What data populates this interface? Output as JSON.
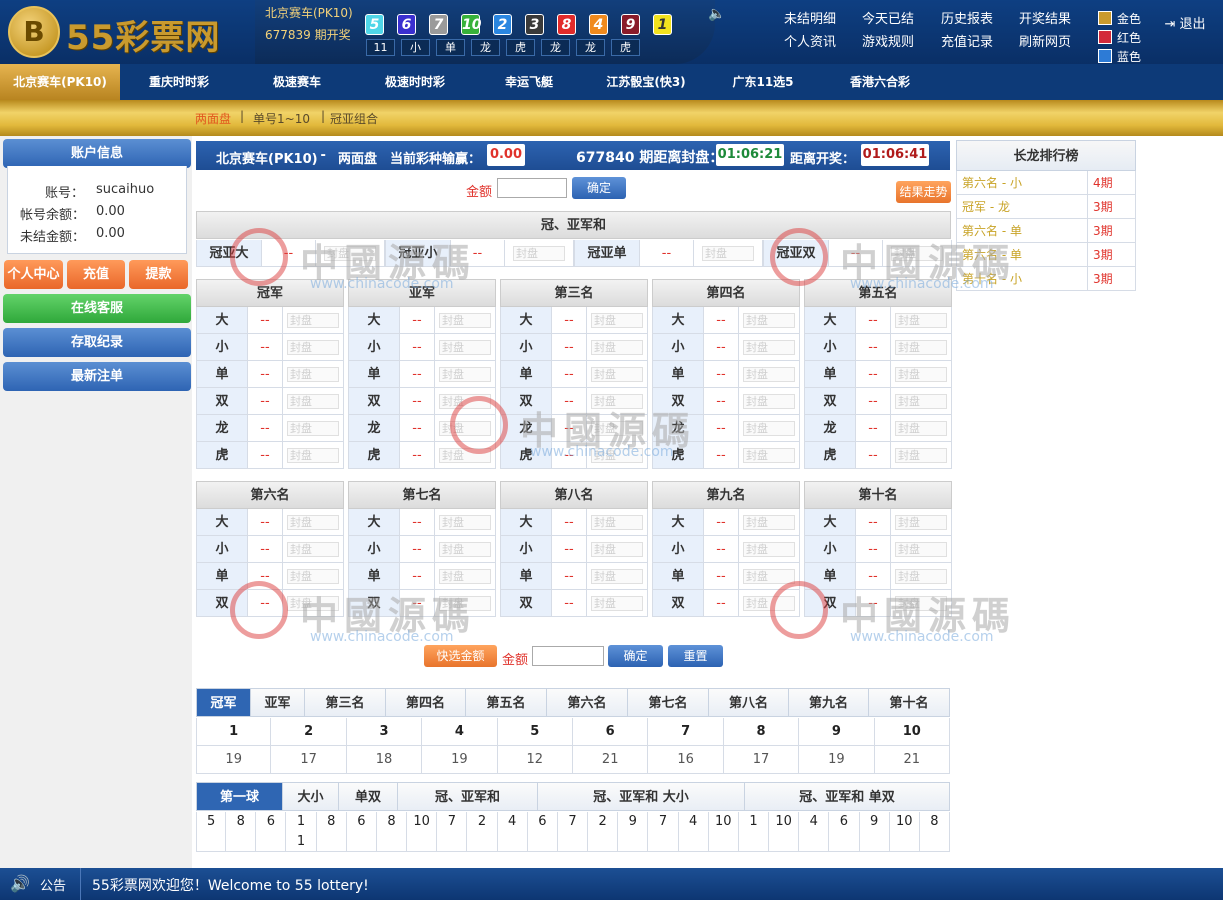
{
  "header": {
    "logo_mark": "B",
    "logo_text": "55彩票网",
    "game_name": "北京赛车(PK10)",
    "period_text": "677839 期开奖",
    "balls": [
      {
        "n": "5",
        "color": "#4fd6e8"
      },
      {
        "n": "6",
        "color": "#3a2fd0"
      },
      {
        "n": "7",
        "color": "#9a9a9a"
      },
      {
        "n": "10",
        "color": "#38b23a"
      },
      {
        "n": "2",
        "color": "#2a86e0"
      },
      {
        "n": "3",
        "color": "#3a3a3a"
      },
      {
        "n": "8",
        "color": "#e22b2b"
      },
      {
        "n": "4",
        "color": "#f08a1e"
      },
      {
        "n": "9",
        "color": "#8a1b2a"
      },
      {
        "n": "1",
        "color": "#f2e21e"
      }
    ],
    "results": [
      "11",
      "小",
      "单",
      "龙",
      "虎",
      "龙",
      "龙",
      "虎"
    ],
    "links": [
      "未结明细",
      "今天已结",
      "历史报表",
      "开奖结果",
      "个人资讯",
      "游戏规则",
      "充值记录",
      "刷新网页"
    ],
    "themes": [
      {
        "label": "金色",
        "color": "#c99a2e"
      },
      {
        "label": "红色",
        "color": "#d32a3a"
      },
      {
        "label": "蓝色",
        "color": "#2d7bd6"
      }
    ],
    "logout": "退出"
  },
  "nav": [
    "北京赛车(PK10)",
    "重庆时时彩",
    "极速赛车",
    "极速时时彩",
    "幸运飞艇",
    "江苏骰宝(快3)",
    "广东11选5",
    "香港六合彩"
  ],
  "subnav": [
    "两面盘",
    "单号1~10",
    "冠亚组合"
  ],
  "left": {
    "account_title": "账户信息",
    "account_label": "账号：",
    "account_value": "sucaihuo",
    "balance_label": "帐号余额：",
    "balance_value": "0.00",
    "unsettled_label": "未结金额：",
    "unsettled_value": "0.00",
    "btn_center": "个人中心",
    "btn_deposit": "充值",
    "btn_withdraw": "提款",
    "btn_service": "在线客服",
    "btn_records": "存取纪录",
    "btn_latest": "最新注单"
  },
  "info": {
    "game": "北京赛车(PK10)",
    "sep": " - ",
    "mode": "两面盘",
    "winloss_label": "当前彩种输赢：",
    "winloss": "0.00",
    "period_label": "677840 期距离封盘：",
    "close_time": "01:06:21",
    "draw_label": "距离开奖：",
    "draw_time": "01:06:41"
  },
  "bet": {
    "amount_label": "金额",
    "confirm": "确定",
    "trend": "结果走势",
    "quick": "快选金额",
    "reset": "重置"
  },
  "sum_title": "冠、亚军和",
  "sum_items": [
    "冠亚大",
    "冠亚小",
    "冠亚单",
    "冠亚双"
  ],
  "odds_placeholder": "--",
  "sealed": "封盘",
  "positions_a": [
    "冠军",
    "亚军",
    "第三名",
    "第四名",
    "第五名"
  ],
  "positions_b": [
    "第六名",
    "第七名",
    "第八名",
    "第九名",
    "第十名"
  ],
  "opts_a": [
    "大",
    "小",
    "单",
    "双",
    "龙",
    "虎"
  ],
  "opts_b": [
    "大",
    "小",
    "单",
    "双"
  ],
  "dragon": {
    "title": "长龙排行榜",
    "rows": [
      {
        "name": "第六名 - 小",
        "count": "4期"
      },
      {
        "name": "冠军 - 龙",
        "count": "3期"
      },
      {
        "name": "第六名 - 单",
        "count": "3期"
      },
      {
        "name": "第六名 - 单",
        "count": "3期"
      },
      {
        "name": "第十名 - 小",
        "count": "3期"
      }
    ]
  },
  "stats": {
    "tabs": [
      "冠军",
      "亚军",
      "第三名",
      "第四名",
      "第五名",
      "第六名",
      "第七名",
      "第八名",
      "第九名",
      "第十名"
    ],
    "numbers": [
      "1",
      "2",
      "3",
      "4",
      "5",
      "6",
      "7",
      "8",
      "9",
      "10"
    ],
    "counts": [
      "19",
      "17",
      "18",
      "19",
      "12",
      "21",
      "16",
      "17",
      "19",
      "21"
    ]
  },
  "road": {
    "tabs": [
      "第一球",
      "大小",
      "单双",
      "冠、亚军和",
      "冠、亚军和 大小",
      "冠、亚军和 单双"
    ],
    "cells": [
      "5",
      "8",
      "6",
      "1\n1",
      "8",
      "6",
      "8",
      "10",
      "7",
      "2",
      "4",
      "6",
      "7",
      "2",
      "9",
      "7",
      "4",
      "10",
      "1",
      "10",
      "4",
      "6",
      "9",
      "10",
      "8"
    ]
  },
  "watermark": {
    "text": "中國源碼",
    "sub": "www.chinacode.com"
  },
  "footer": {
    "label": "公告",
    "message": "55彩票网欢迎您！Welcome to 55 lottery!"
  }
}
